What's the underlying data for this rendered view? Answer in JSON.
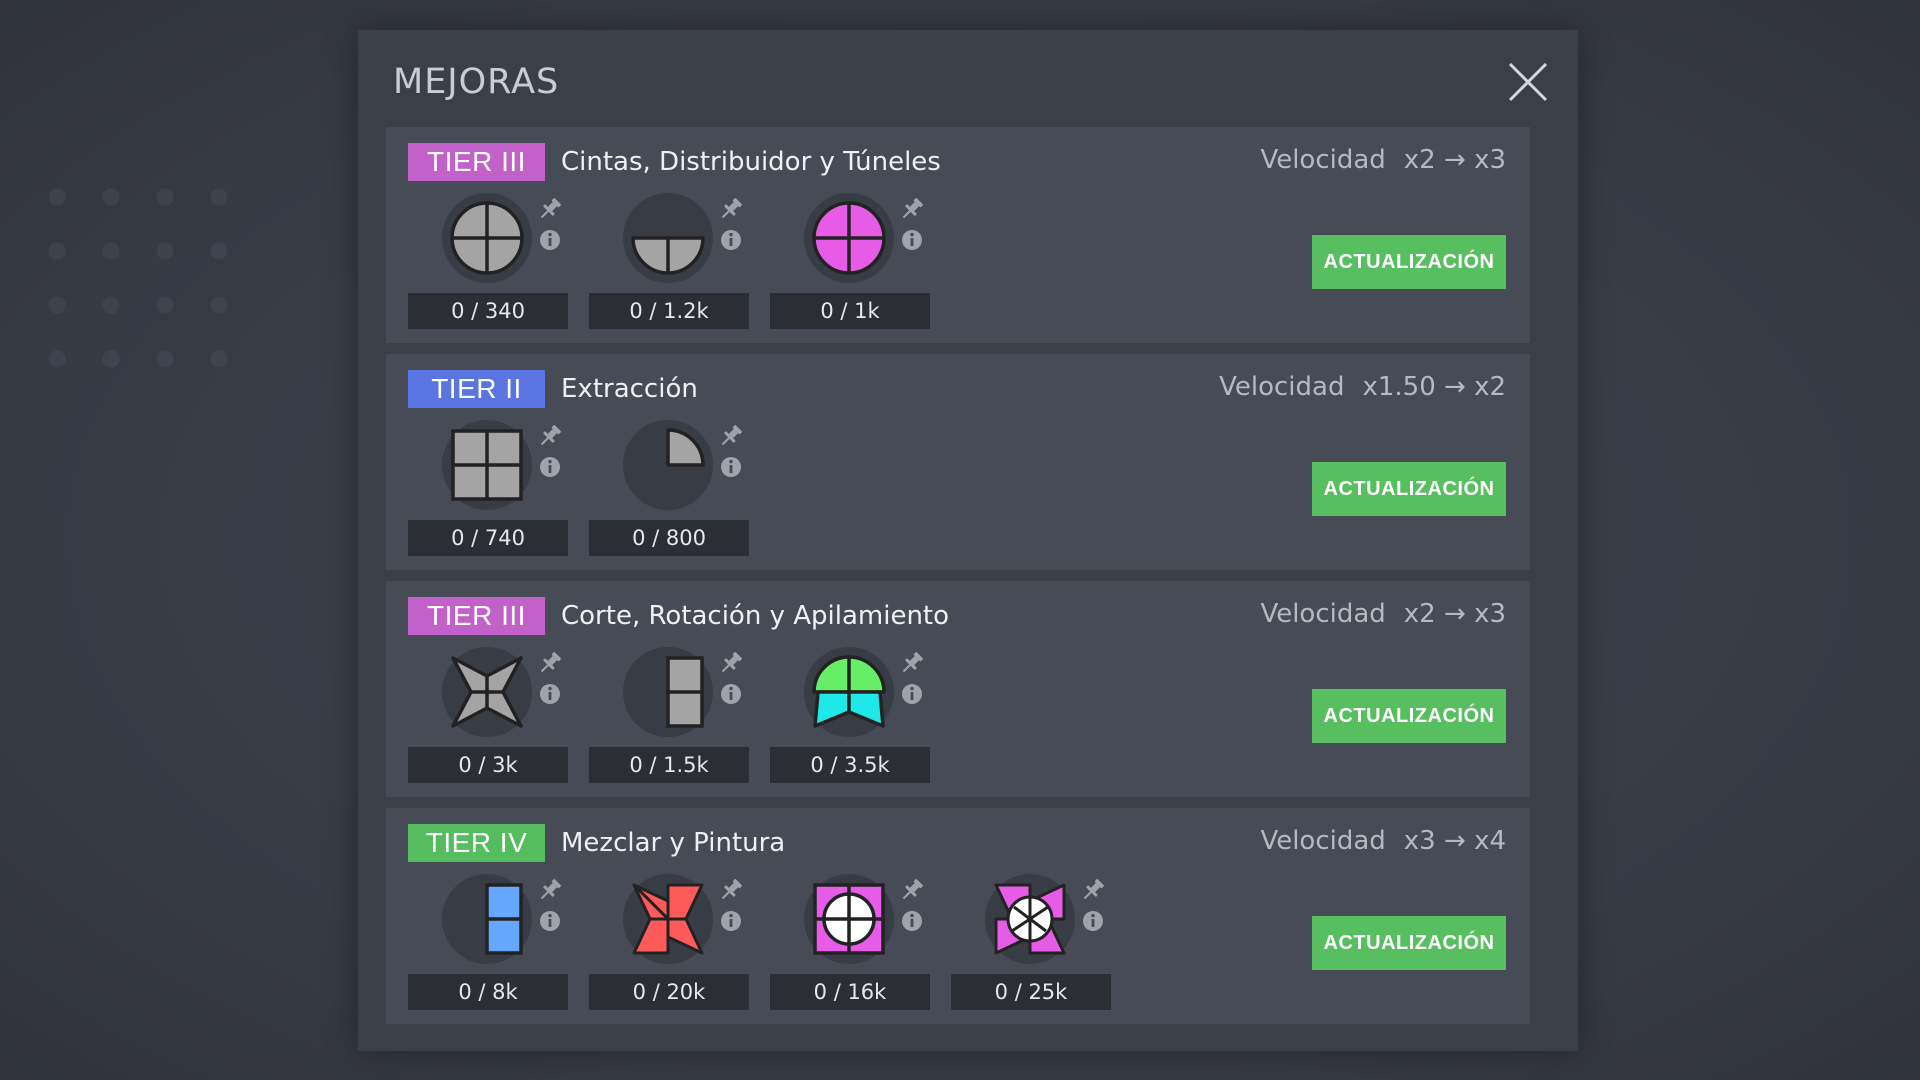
{
  "modal": {
    "title": "MEJORAS"
  },
  "colors": {
    "tier_ii": "#5a75e0",
    "tier_iii": "#c261c9",
    "tier_iv": "#56bd5f",
    "button": "#57bf5f"
  },
  "tiers": [
    {
      "badge": "TIER III",
      "name": "Cintas, Distribuidor y Túneles",
      "speed_label": "Velocidad",
      "speed_from": "x2",
      "arrow": "→",
      "speed_to": "x3",
      "button": "ACTUALIZACIÓN",
      "requirements": [
        {
          "icon": "circle-quartered-gray-shape-icon",
          "count": "0 / 340"
        },
        {
          "icon": "half-circle-gray-shape-icon",
          "count": "0 / 1.2k"
        },
        {
          "icon": "circle-quartered-purple-shape-icon",
          "count": "0 / 1k"
        }
      ]
    },
    {
      "badge": "TIER II",
      "name": "Extracción",
      "speed_label": "Velocidad",
      "speed_from": "x1.50",
      "arrow": "→",
      "speed_to": "x2",
      "button": "ACTUALIZACIÓN",
      "requirements": [
        {
          "icon": "square-quartered-gray-shape-icon",
          "count": "0 / 740"
        },
        {
          "icon": "quarter-circle-gray-shape-icon",
          "count": "0 / 800"
        }
      ]
    },
    {
      "badge": "TIER III",
      "name": "Corte, Rotación y Apilamiento",
      "speed_label": "Velocidad",
      "speed_from": "x2",
      "arrow": "→",
      "speed_to": "x3",
      "button": "ACTUALIZACIÓN",
      "requirements": [
        {
          "icon": "star-gray-shape-icon",
          "count": "0 / 3k"
        },
        {
          "icon": "half-rectangle-gray-shape-icon",
          "count": "0 / 1.5k"
        },
        {
          "icon": "green-cyan-compound-shape-icon",
          "count": "0 / 3.5k"
        }
      ]
    },
    {
      "badge": "TIER IV",
      "name": "Mezclar y Pintura",
      "speed_label": "Velocidad",
      "speed_from": "x3",
      "arrow": "→",
      "speed_to": "x4",
      "button": "ACTUALIZACIÓN",
      "requirements": [
        {
          "icon": "blue-half-rectangle-shape-icon",
          "count": "0 / 8k"
        },
        {
          "icon": "red-windmill-shape-icon",
          "count": "0 / 20k"
        },
        {
          "icon": "purple-square-white-circle-shape-icon",
          "count": "0 / 16k"
        },
        {
          "icon": "complex-purple-white-shape-icon",
          "count": "0 / 25k"
        }
      ]
    }
  ]
}
